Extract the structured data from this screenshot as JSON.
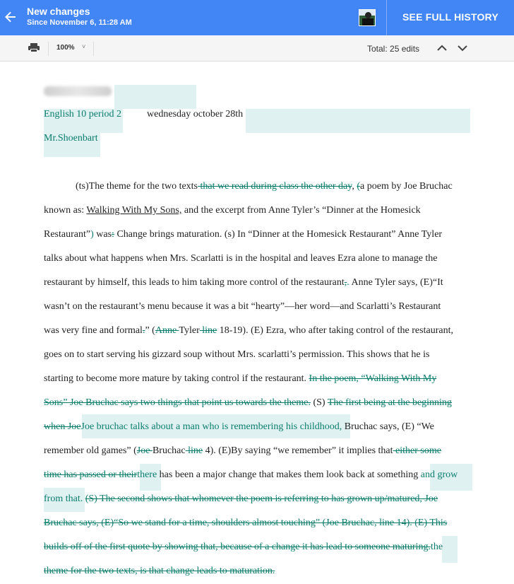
{
  "header": {
    "title": "New changes",
    "subtitle": "Since November 6, 11:28 AM",
    "history_button": "SEE FULL HISTORY"
  },
  "toolbar": {
    "zoom": "100%",
    "zoom_caret": "˅",
    "edits": "Total: 25 edits"
  },
  "colors": {
    "brand": "#4285f4",
    "insert_text": "#0b7c6c",
    "highlight": "#dff2f1"
  },
  "icons": [
    "back-arrow-icon",
    "avatar",
    "print-icon",
    "chevron-up-icon",
    "chevron-down-icon"
  ],
  "doc": {
    "l1": {
      "a": "English 10 period 2",
      "b": "wednesday october 28th"
    },
    "l2": {
      "a": "Mr.Shoenbart"
    },
    "p1": {
      "a": "(ts)The theme for the two texts",
      "b": " that we read during class the other day",
      "c": ", ",
      "d": "(",
      "e": "a poem by Joe Bruchac"
    },
    "p2": {
      "a": "known as: ",
      "b": "Walking With My Sons,",
      "c": " and the excerpt from Anne Tyler’s “Dinner at the Homesick"
    },
    "p3": {
      "a": "Restaurant”",
      "b": ")",
      "c": " was",
      "d": ":",
      "e": " Change brings maturation. (s) In “Dinner at the Homesick Restaurant” Anne Tyler"
    },
    "p4": {
      "a": "talks about what happens when Mrs. Scarlatti is in the hospital and leaves Ezra alone to manage the"
    },
    "p5": {
      "a": "restaurant by himself, this leads to him taking more control of the restaurant",
      "b": ",",
      "c": ".",
      "d": " Anne Tyler says, (E)“It"
    },
    "p6": {
      "a": "wasn’t on the restaurant’s menu because it was a bit “hearty”—her word—and Scarlatti’s Restaurant"
    },
    "p7": {
      "a": "was very fine and formal",
      "b": ".",
      "c": "” (",
      "d": "Anne ",
      "e": "Tyler",
      "f": " line",
      "g": " 18-19). (E) Ezra, who after taking control of the restaurant,"
    },
    "p8": {
      "a": "goes on to start serving his gizzard soup without Mrs. scarlatti’s permission. This shows that he is"
    },
    "p9": {
      "a": "starting to become more mature by taking control if the restaurant. ",
      "b": "In the poem, “Walking With My"
    },
    "p10": {
      "a": "Sons” Joe Bruchac says two things that point us towards the theme.",
      "b": " (S) ",
      "c": "The first being at the beginning"
    },
    "p11": {
      "a": "when Joe",
      "b": "Joe bruchac talks about a man who is remembering his childhood,",
      "c": " Bruchac says, (E) “We"
    },
    "p12": {
      "a": "remember old games” (",
      "b": "Joe ",
      "c": "Bruchac",
      "d": " line",
      "e": " 4). (E)By saying “we remember” it implies that",
      "f": " either some"
    },
    "p13": {
      "a": "time has passed or their",
      "b": "there",
      "c": " has been a major change that makes them look back at something ",
      "d": "and grow"
    },
    "p14": {
      "a": "from that.",
      "b": " ",
      "c": "(S) The second shows that whomever the poem is referring to has grown up/matured, Joe"
    },
    "p15": {
      "a": "Bruchac says, (E)“So we stand for a time, shoulders almost touching” (Joe Bruchac, line 14). (E) This"
    },
    "p16": {
      "a": "builds off of the first quote by showing that, because of a change it has lead to someone maturing.",
      "b": "the"
    },
    "p17": {
      "a": "theme for the two texts, is that change leads to maturation."
    }
  }
}
